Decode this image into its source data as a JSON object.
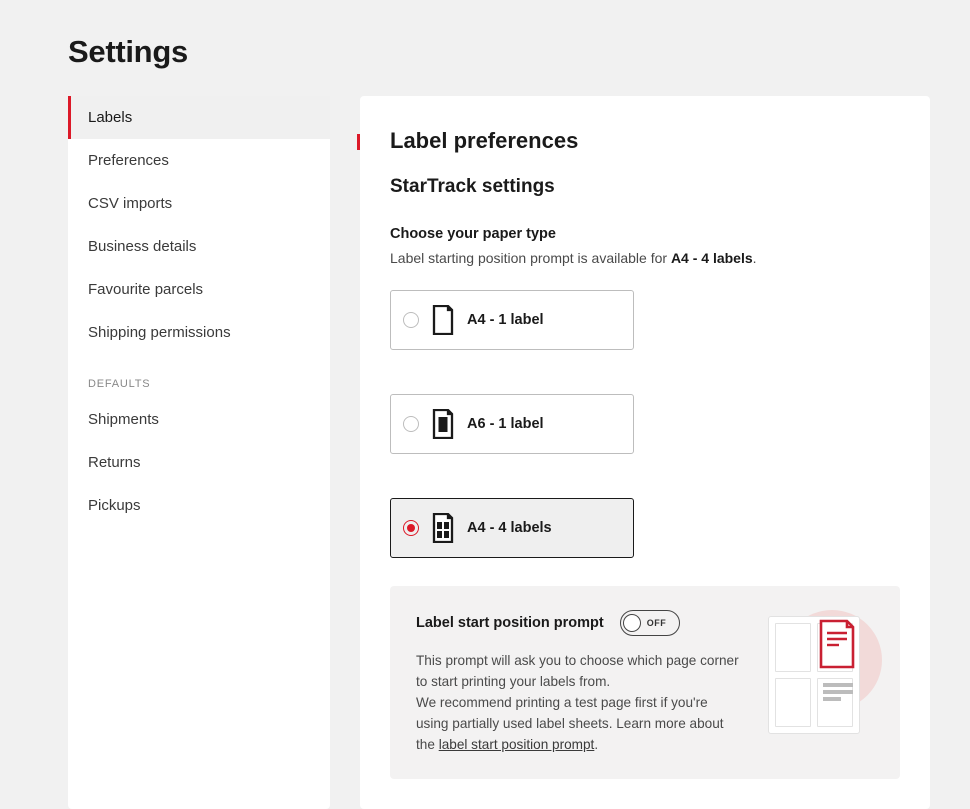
{
  "page_title": "Settings",
  "sidebar": {
    "items": [
      {
        "label": "Labels",
        "active": true
      },
      {
        "label": "Preferences",
        "active": false
      },
      {
        "label": "CSV imports",
        "active": false
      },
      {
        "label": "Business details",
        "active": false
      },
      {
        "label": "Favourite parcels",
        "active": false
      },
      {
        "label": "Shipping permissions",
        "active": false
      }
    ],
    "defaults_title": "DEFAULTS",
    "defaults_items": [
      {
        "label": "Shipments"
      },
      {
        "label": "Returns"
      },
      {
        "label": "Pickups"
      }
    ]
  },
  "main": {
    "section_title": "Label preferences",
    "subsection_title": "StarTrack settings",
    "paper_type": {
      "label": "Choose your paper type",
      "desc_prefix": "Label starting position prompt is available for ",
      "desc_bold": "A4 - 4 labels",
      "desc_suffix": ".",
      "options": [
        {
          "id": "a4-1",
          "label": "A4 - 1 label",
          "selected": false
        },
        {
          "id": "a6-1",
          "label": "A6 - 1 label",
          "selected": false
        },
        {
          "id": "a4-4",
          "label": "A4 - 4 labels",
          "selected": true
        }
      ]
    },
    "prompt": {
      "title": "Label start position prompt",
      "toggle_state": "OFF",
      "desc_line1": "This prompt will ask you to choose which page corner to start printing your labels from.",
      "desc_line2_a": "We recommend printing a test page first if you're using partially used label sheets. Learn more about the ",
      "desc_link": "label start position prompt",
      "desc_line2_b": "."
    }
  }
}
